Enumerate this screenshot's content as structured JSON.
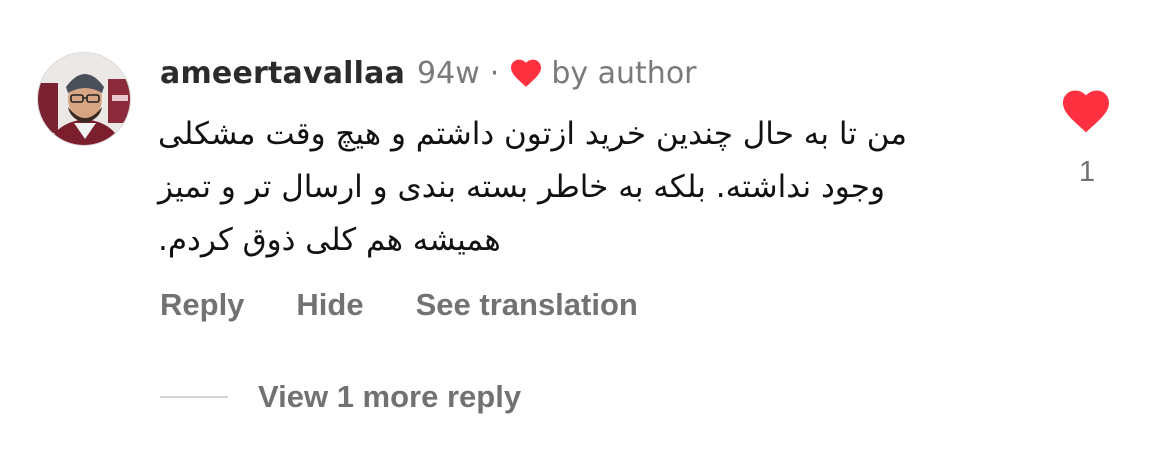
{
  "comment": {
    "username": "ameertavallaa",
    "time": "94w",
    "separator": "·",
    "liked_by_author_label": "by author",
    "text": "من تا به حال چندین خرید ازتون داشتم و هیچ وقت مشکلی وجود نداشته. بلکه به خاطر بسته بندی و ارسال تر و تمیز همیشه هم کلی ذوق کردم.",
    "like_count": "1"
  },
  "actions": {
    "reply": "Reply",
    "hide": "Hide",
    "see_translation": "See translation"
  },
  "replies": {
    "view_more_label": "View 1 more reply"
  },
  "colors": {
    "heart": "#ff3040",
    "secondary_text": "#737373",
    "divider": "#d6d6d6"
  },
  "icons": {
    "avatar": "user-avatar",
    "author_heart": "heart-filled-icon",
    "like": "heart-filled-icon"
  }
}
